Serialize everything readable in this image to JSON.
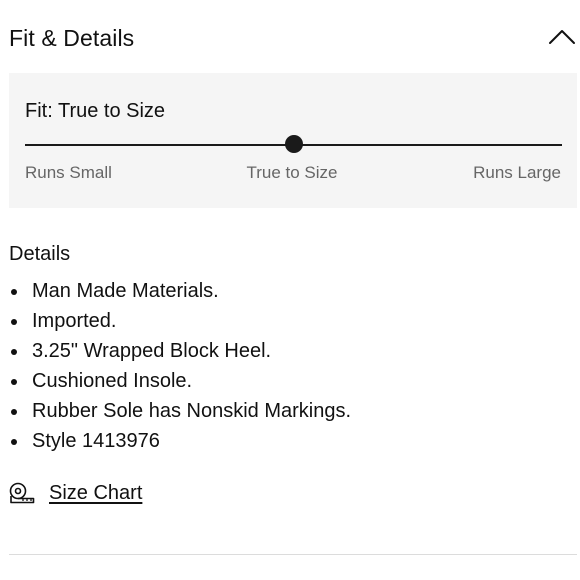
{
  "section": {
    "title": "Fit & Details",
    "collapse_icon": "chevron-up-icon"
  },
  "fit": {
    "title": "Fit: True to Size",
    "position_fraction": 0.5,
    "labels": {
      "small": "Runs Small",
      "middle": "True to Size",
      "large": "Runs Large"
    }
  },
  "details": {
    "heading": "Details",
    "items": [
      "Man Made Materials.",
      "Imported.",
      "3.25\" Wrapped Block Heel.",
      "Cushioned Insole.",
      "Rubber Sole has Nonskid Markings.",
      "Style 1413976"
    ]
  },
  "size_chart": {
    "icon": "tape-measure-icon",
    "label": "Size Chart"
  }
}
